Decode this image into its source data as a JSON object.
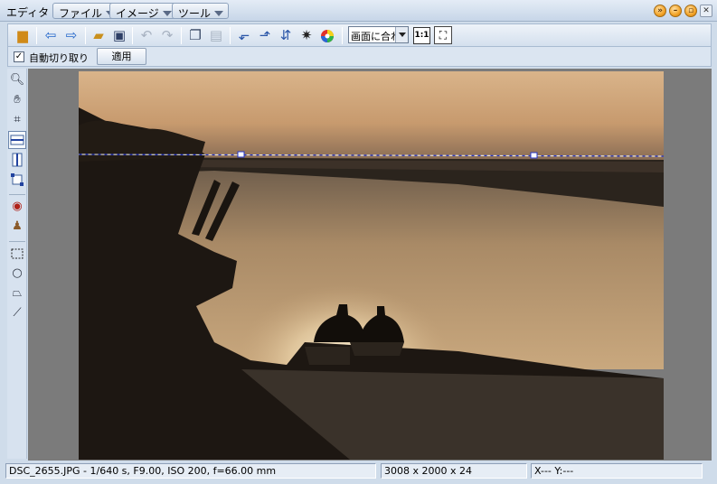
{
  "app": {
    "title": "エディタ"
  },
  "menus": [
    {
      "label": "ファイル"
    },
    {
      "label": "イメージ"
    },
    {
      "label": "ツール"
    }
  ],
  "toolbar": {
    "zoom_value": "画面に合わ"
  },
  "options": {
    "auto_crop_label": "自動切り取り",
    "auto_crop_checked": true,
    "apply_label": "適用"
  },
  "status": {
    "file_info": "DSC_2655.JPG - 1/640 s, F9.00, ISO 200, f=66.00 mm",
    "dimensions": "3008 x 2000 x 24",
    "coords": "X---  Y:---"
  },
  "colors": {
    "chrome": "#cfdcea",
    "canvas_bg": "#7b7b7b",
    "window_button": "#f2a226"
  },
  "icons": {
    "toolbar": [
      "open-icon",
      "back-arrow-icon",
      "forward-arrow-icon",
      "folder-open-icon",
      "save-icon",
      "undo-icon",
      "redo-icon",
      "copy-icon",
      "paste-icon",
      "rotate-left-icon",
      "rotate-right-icon",
      "flip-icon",
      "brightness-icon",
      "color-wheel-icon",
      "actual-size-icon",
      "fit-screen-icon"
    ],
    "tools": [
      "zoom-icon",
      "hand-icon",
      "crop-icon",
      "horizontal-line-icon",
      "vertical-line-icon",
      "resize-icon",
      "red-eye-icon",
      "stamp-icon",
      "rect-select-icon",
      "lasso-icon",
      "polygon-select-icon",
      "magic-wand-icon"
    ]
  }
}
